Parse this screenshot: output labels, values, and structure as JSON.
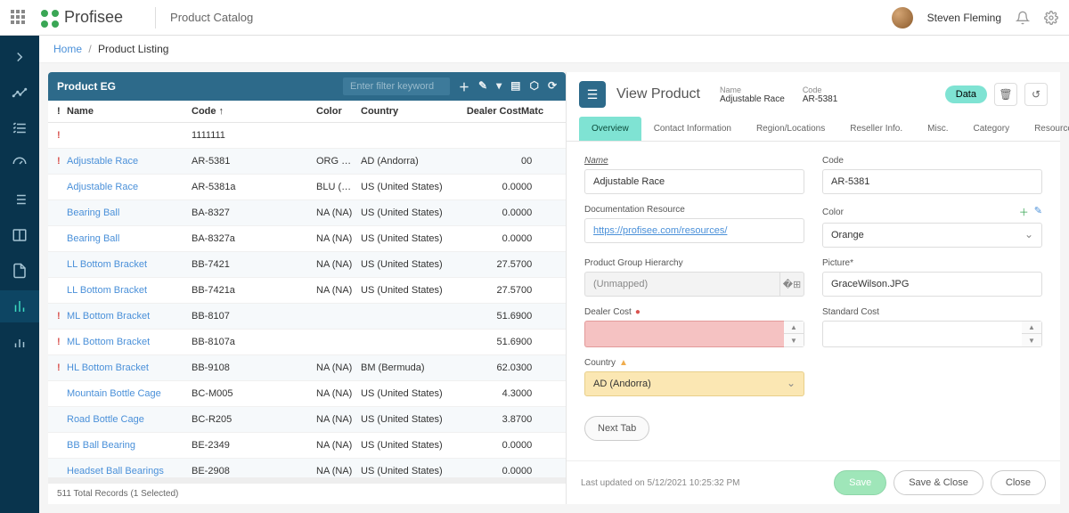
{
  "brand": "Profisee",
  "page_title": "Product Catalog",
  "user": {
    "name": "Steven Fleming"
  },
  "breadcrumb": {
    "home": "Home",
    "current": "Product Listing"
  },
  "grid": {
    "title": "Product EG",
    "search_placeholder": "Enter filter keyword",
    "columns": {
      "name": "Name",
      "code": "Code ↑",
      "color": "Color",
      "country": "Country",
      "dealer_cost": "Dealer Cost",
      "match": "Matc"
    },
    "rows": [
      {
        "alert": true,
        "name": "",
        "code": "1111111",
        "color": "",
        "country": "",
        "cost": "",
        "match": ""
      },
      {
        "alert": true,
        "name": "Adjustable Race",
        "code": "AR-5381",
        "color": "ORG …",
        "country": "AD (Andorra)",
        "cost": "",
        "match": "00"
      },
      {
        "alert": false,
        "name": "Adjustable Race",
        "code": "AR-5381a",
        "color": "BLU (…",
        "country": "US (United States)",
        "cost": "0.00",
        "match": "00"
      },
      {
        "alert": false,
        "name": "Bearing Ball",
        "code": "BA-8327",
        "color": "NA (NA)",
        "country": "US (United States)",
        "cost": "0.00",
        "match": "00"
      },
      {
        "alert": false,
        "name": "Bearing Ball",
        "code": "BA-8327a",
        "color": "NA (NA)",
        "country": "US (United States)",
        "cost": "0.00",
        "match": "00"
      },
      {
        "alert": false,
        "name": "LL Bottom Bracket",
        "code": "BB-7421",
        "color": "NA (NA)",
        "country": "US (United States)",
        "cost": "27.57",
        "match": "00"
      },
      {
        "alert": false,
        "name": "LL Bottom Bracket",
        "code": "BB-7421a",
        "color": "NA (NA)",
        "country": "US (United States)",
        "cost": "27.57",
        "match": "00"
      },
      {
        "alert": true,
        "name": "ML Bottom Bracket",
        "code": "BB-8107",
        "color": "",
        "country": "",
        "cost": "51.69",
        "match": "00"
      },
      {
        "alert": true,
        "name": "ML Bottom Bracket",
        "code": "BB-8107a",
        "color": "",
        "country": "",
        "cost": "51.69",
        "match": "00"
      },
      {
        "alert": true,
        "name": "HL Bottom Bracket",
        "code": "BB-9108",
        "color": "NA (NA)",
        "country": "BM (Bermuda)",
        "cost": "62.03",
        "match": "00"
      },
      {
        "alert": false,
        "name": "Mountain Bottle Cage",
        "code": "BC-M005",
        "color": "NA (NA)",
        "country": "US (United States)",
        "cost": "4.30",
        "match": "00"
      },
      {
        "alert": false,
        "name": "Road Bottle Cage",
        "code": "BC-R205",
        "color": "NA (NA)",
        "country": "US (United States)",
        "cost": "3.87",
        "match": "00"
      },
      {
        "alert": false,
        "name": "BB Ball Bearing",
        "code": "BE-2349",
        "color": "NA (NA)",
        "country": "US (United States)",
        "cost": "0.00",
        "match": "00"
      },
      {
        "alert": false,
        "name": "Headset Ball Bearings",
        "code": "BE-2908",
        "color": "NA (NA)",
        "country": "US (United States)",
        "cost": "0.00",
        "match": "00"
      }
    ],
    "footer": "511 Total Records (1 Selected)"
  },
  "detail": {
    "title": "View Product",
    "meta": {
      "name_label": "Name",
      "name_value": "Adjustable Race",
      "code_label": "Code",
      "code_value": "AR-5381"
    },
    "data_btn": "Data",
    "tabs": [
      "Overview",
      "Contact Information",
      "Region/Locations",
      "Reseller Info.",
      "Misc.",
      "Category",
      "Resources"
    ],
    "tabs_more": "…",
    "form": {
      "name_label": "Name",
      "name_value": "Adjustable Race",
      "code_label": "Code",
      "code_value": "AR-5381",
      "doc_label": "Documentation Resource",
      "doc_value": "https://profisee.com/resources/",
      "color_label": "Color",
      "color_value": "Orange",
      "pgh_label": "Product Group Hierarchy",
      "pgh_value": "(Unmapped)",
      "picture_label": "Picture*",
      "picture_value": "GraceWilson.JPG",
      "dealer_label": "Dealer Cost",
      "dealer_value": "",
      "standard_label": "Standard Cost",
      "standard_value": "",
      "country_label": "Country",
      "country_value": "AD (Andorra)"
    },
    "next_tab": "Next Tab",
    "updated": "Last updated on 5/12/2021 10:25:32 PM",
    "actions": {
      "save": "Save",
      "save_close": "Save & Close",
      "close": "Close"
    }
  }
}
